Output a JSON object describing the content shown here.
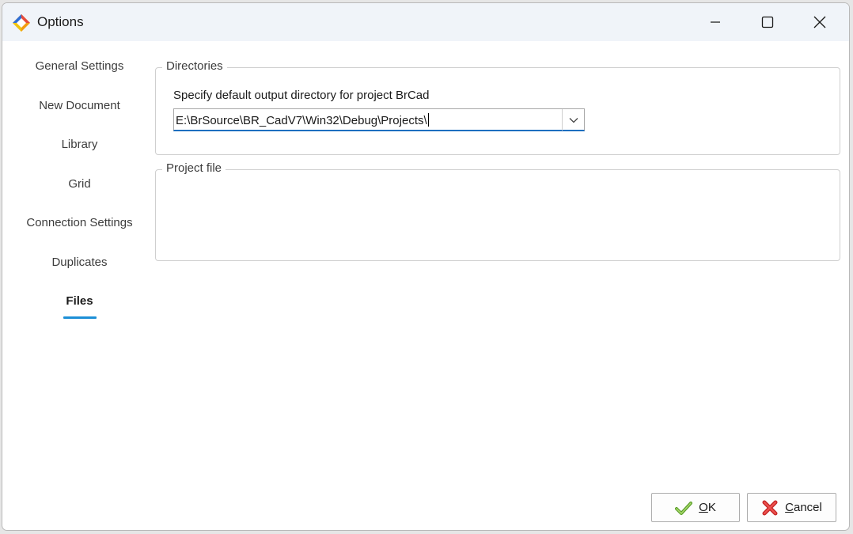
{
  "window": {
    "title": "Options",
    "icon": "app-diamond-icon"
  },
  "titlebar_buttons": {
    "minimize_icon": "minimize-icon",
    "maximize_icon": "maximize-icon",
    "close_icon": "close-icon"
  },
  "nav": {
    "items": [
      {
        "label": "General Settings"
      },
      {
        "label": "New Document"
      },
      {
        "label": "Library"
      },
      {
        "label": "Grid"
      },
      {
        "label": "Connection Settings"
      },
      {
        "label": "Duplicates"
      },
      {
        "label": "Files",
        "active": true
      }
    ],
    "accent_color": "#1d8fd6"
  },
  "directories": {
    "title": "Directories",
    "label": "Specify default output directory for project BrCad",
    "value": "E:\\BrSource\\BR_CadV7\\Win32\\Debug\\Projects\\"
  },
  "project_file": {
    "title": "Project file"
  },
  "footer": {
    "ok": {
      "accel": "O",
      "rest": "K",
      "icon": "checkmark-icon"
    },
    "cancel": {
      "accel": "C",
      "rest": "ancel",
      "icon": "cancel-x-icon"
    }
  }
}
